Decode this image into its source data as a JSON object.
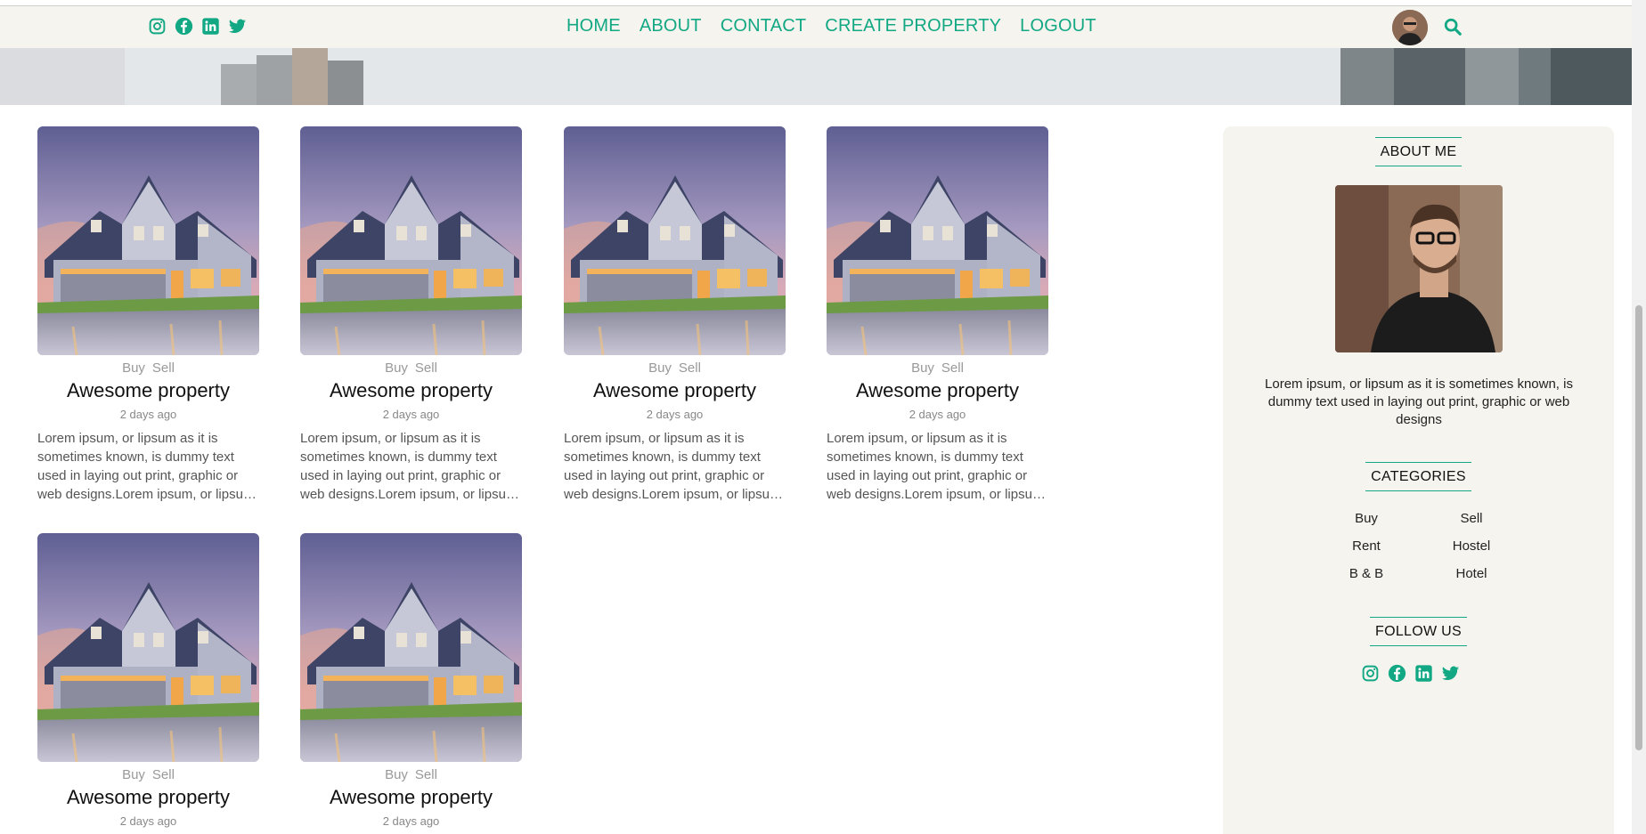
{
  "nav": {
    "social": [
      "instagram-icon",
      "facebook-icon",
      "linkedin-icon",
      "twitter-icon"
    ],
    "links": [
      "HOME",
      "ABOUT",
      "CONTACT",
      "CREATE PROPERTY",
      "LOGOUT"
    ]
  },
  "posts": [
    {
      "tags": [
        "Buy",
        "Sell"
      ],
      "title": "Awesome property",
      "date": "2 days ago",
      "desc": "Lorem ipsum, or lipsum as it is sometimes known, is dummy text used in laying out print, graphic or web designs.Lorem ipsum, or lipsum as it is sometimes known, is dummy text used in laying out print, graphic or web designs."
    },
    {
      "tags": [
        "Buy",
        "Sell"
      ],
      "title": "Awesome property",
      "date": "2 days ago",
      "desc": "Lorem ipsum, or lipsum as it is sometimes known, is dummy text used in laying out print, graphic or web designs.Lorem ipsum, or lipsum as it is sometimes known, is dummy text used in laying out print, graphic or web designs."
    },
    {
      "tags": [
        "Buy",
        "Sell"
      ],
      "title": "Awesome property",
      "date": "2 days ago",
      "desc": "Lorem ipsum, or lipsum as it is sometimes known, is dummy text used in laying out print, graphic or web designs.Lorem ipsum, or lipsum as it is sometimes known, is dummy text used in laying out print, graphic or web designs."
    },
    {
      "tags": [
        "Buy",
        "Sell"
      ],
      "title": "Awesome property",
      "date": "2 days ago",
      "desc": "Lorem ipsum, or lipsum as it is sometimes known, is dummy text used in laying out print, graphic or web designs.Lorem ipsum, or lipsum as it is sometimes known, is dummy text used in laying out print, graphic or web designs."
    },
    {
      "tags": [
        "Buy",
        "Sell"
      ],
      "title": "Awesome property",
      "date": "2 days ago",
      "desc": ""
    },
    {
      "tags": [
        "Buy",
        "Sell"
      ],
      "title": "Awesome property",
      "date": "2 days ago",
      "desc": ""
    }
  ],
  "sidebar": {
    "about_title": "ABOUT ME",
    "about_text": "Lorem ipsum, or lipsum as it is sometimes known, is dummy text used in laying out print, graphic or web designs",
    "categories_title": "CATEGORIES",
    "categories": [
      "Buy",
      "Sell",
      "Rent",
      "Hostel",
      "B & B",
      "Hotel"
    ],
    "follow_title": "FOLLOW US",
    "social": [
      "instagram-icon",
      "facebook-icon",
      "linkedin-icon",
      "twitter-icon"
    ]
  },
  "colors": {
    "accent": "#12a884",
    "panel": "#f6f4ef"
  }
}
